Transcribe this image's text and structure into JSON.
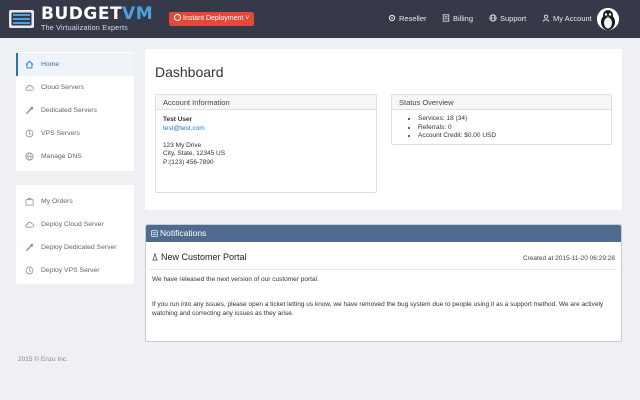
{
  "brand": {
    "name_main": "BUDGET",
    "name_accent": "VM",
    "tagline": "The Virtualization Experts"
  },
  "header": {
    "deploy_label": "Instant Deployment ˅",
    "nav": [
      {
        "label": "Reseller",
        "icon": "gear-icon"
      },
      {
        "label": "Billing",
        "icon": "billing-icon"
      },
      {
        "label": "Support",
        "icon": "globe-icon"
      },
      {
        "label": "My Account",
        "icon": "user-icon"
      }
    ]
  },
  "sidebar": {
    "main_items": [
      {
        "label": "Home",
        "icon": "home-icon",
        "active": true
      },
      {
        "label": "Cloud Servers",
        "icon": "cloud-icon"
      },
      {
        "label": "Dedicated Servers",
        "icon": "server-icon"
      },
      {
        "label": "VPS Servers",
        "icon": "vps-icon"
      },
      {
        "label": "Manage DNS",
        "icon": "globe-icon"
      }
    ],
    "order_items": [
      {
        "label": "My Orders",
        "icon": "orders-icon"
      },
      {
        "label": "Deploy Cloud Server",
        "icon": "cloud-icon"
      },
      {
        "label": "Deploy Dedicated Server",
        "icon": "server-icon"
      },
      {
        "label": "Deploy VPS Server",
        "icon": "vps-icon"
      }
    ]
  },
  "dashboard": {
    "title": "Dashboard",
    "account": {
      "heading": "Account Information",
      "name": "Test User",
      "email": "test@test.com",
      "address1": "123 My Drive",
      "address2": "City, State, 12345 US",
      "phone": "P:(123) 456-7890"
    },
    "status": {
      "heading": "Status Overview",
      "items": [
        "Services: 18 (34)",
        "Referrals: 0",
        "Account Credit: $0.00 USD"
      ]
    }
  },
  "notifications": {
    "heading": "Notifications",
    "title": "New Customer Portal",
    "created": "Created at 2015-11-20 06:29:28",
    "paragraph1": "We have released the next version of our customer portal.",
    "paragraph2": "If you run into any issues, please open a ticket letting us know, we have removed the bug system due to people using it as a support method. We are actively watching and correcting any issues as they arise."
  },
  "footer": "2015 © Enzu Inc.",
  "colors": {
    "topbar": "#363a48",
    "accent": "#2c72b8",
    "deploy": "#e5483a",
    "notif_header": "#4f6b8f"
  }
}
